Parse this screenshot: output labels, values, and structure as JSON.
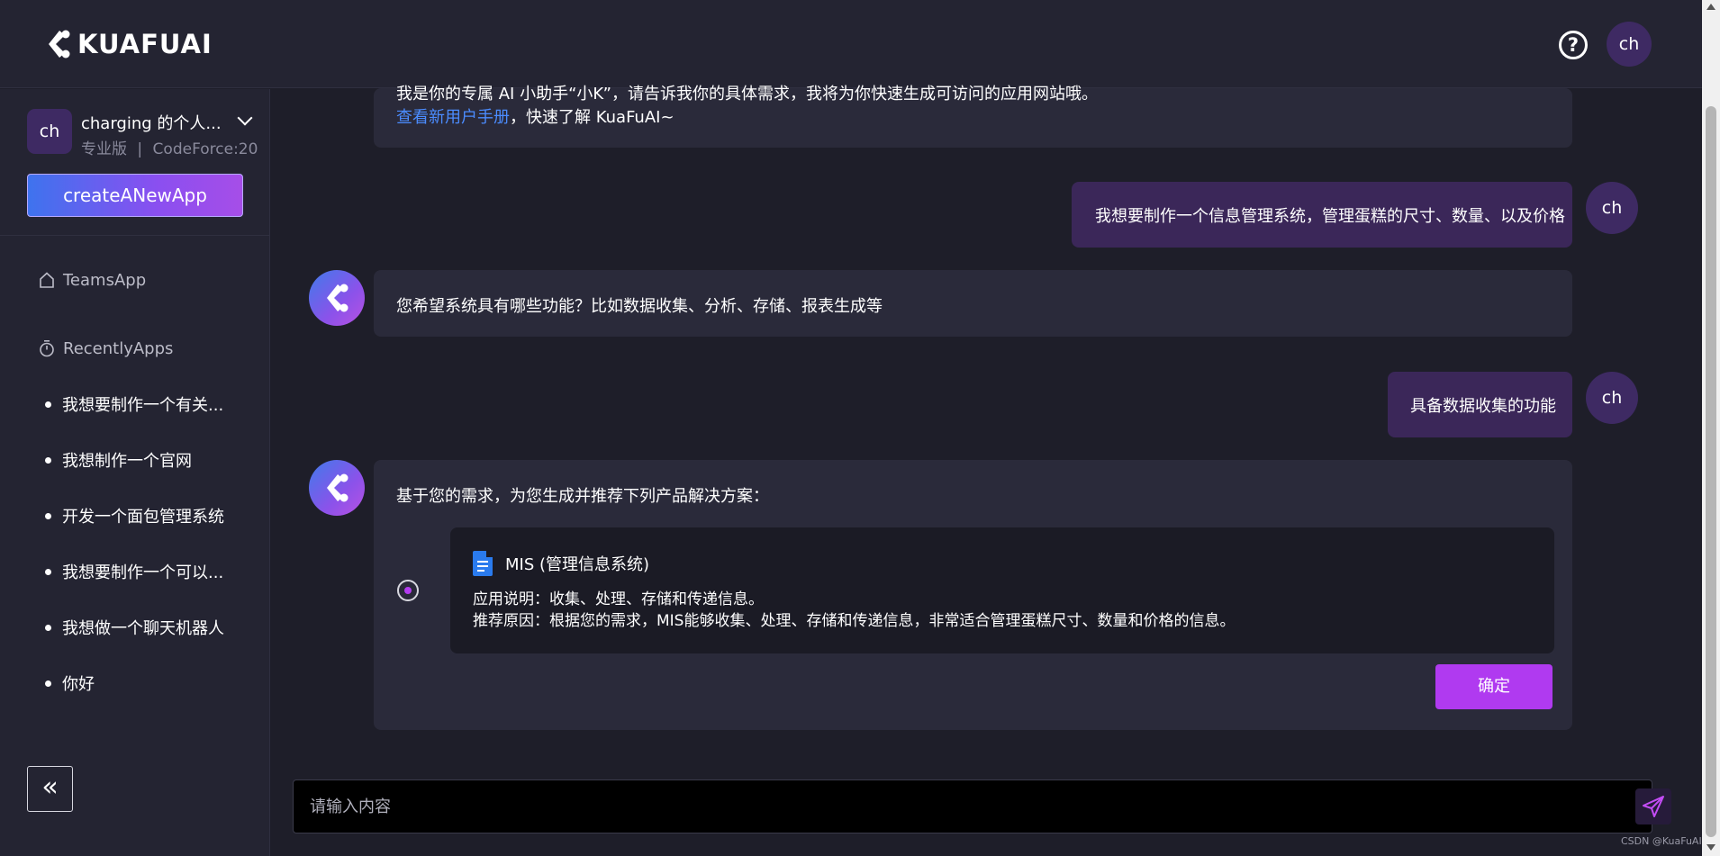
{
  "header": {
    "logo_text": "KUAFUAI",
    "help_glyph": "?",
    "avatar_initials": "ch"
  },
  "sidebar": {
    "user": {
      "initials": "ch",
      "name": "charging 的个人...",
      "plan": "专业版",
      "separator": "|",
      "codeforce": "CodeForce:20"
    },
    "create_button": "createANewApp",
    "nav": [
      {
        "label": "TeamsApp",
        "icon": "home-icon"
      },
      {
        "label": "RecentlyApps",
        "icon": "stopwatch-icon"
      }
    ],
    "recent_apps": [
      "我想要制作一个有关...",
      "我想制作一个官网",
      "开发一个面包管理系统",
      "我想要制作一个可以...",
      "我想做一个聊天机器人",
      "你好"
    ],
    "collapse_glyph": "«"
  },
  "chat": {
    "intro": {
      "line1": "我是你的专属 AI 小助手“小K”，请告诉我你的具体需求，我将为你快速生成可访问的应用网站哦。",
      "link": "查看新用户手册",
      "line2_suffix": "，快速了解 KuaFuAI~"
    },
    "messages": [
      {
        "role": "user",
        "text": "我想要制作一个信息管理系统，管理蛋糕的尺寸、数量、以及价格",
        "initials": "ch"
      },
      {
        "role": "bot",
        "text": "您希望系统具有哪些功能？比如数据收集、分析、存储、报表生成等"
      },
      {
        "role": "user",
        "text": "具备数据收集的功能",
        "initials": "ch"
      }
    ],
    "recommendation": {
      "intro": "基于您的需求，为您生成并推荐下列产品解决方案：",
      "option": {
        "title": "MIS (管理信息系统)",
        "description": "应用说明：收集、处理、存储和传递信息。",
        "reason": "推荐原因：根据您的需求，MIS能够收集、处理、存储和传递信息，非常适合管理蛋糕尺寸、数量和价格的信息。",
        "selected": true
      },
      "confirm_label": "确定"
    }
  },
  "input": {
    "placeholder": "请输入内容",
    "value": ""
  },
  "watermark": "CSDN @KuaFuAI",
  "colors": {
    "accent": "#b03af0",
    "link": "#4b8cff",
    "background": "#1e1e29",
    "panel": "#242432",
    "user_bubble": "#3b2759"
  }
}
